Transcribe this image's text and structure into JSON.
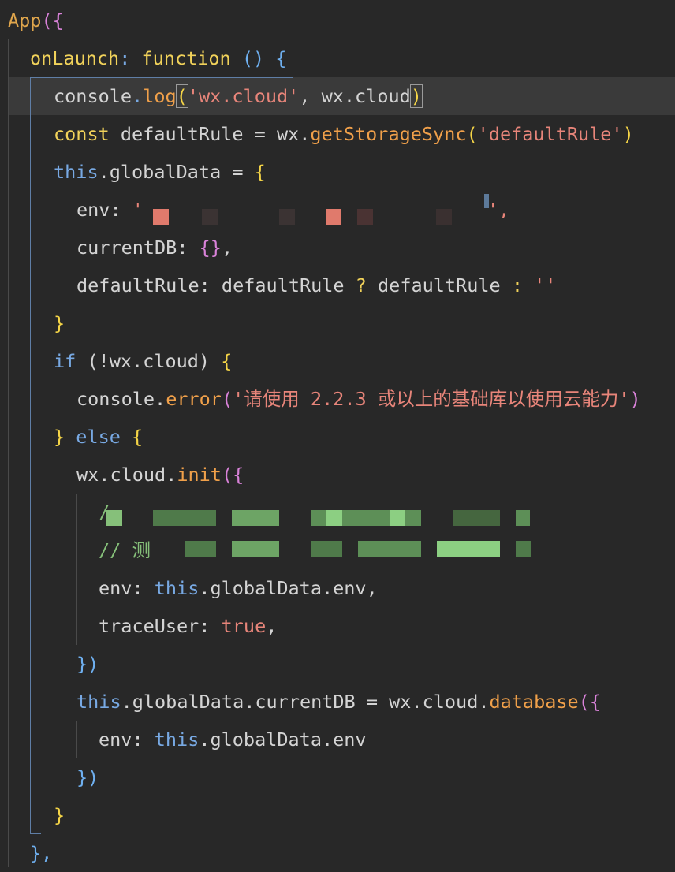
{
  "code": {
    "l1": {
      "app": "App",
      "open": "({"
    },
    "l2": {
      "name": "onLaunch",
      "colon": ":",
      "fn": "function",
      "parens": "()",
      "brace": "{"
    },
    "l3": {
      "obj": "console",
      "dot": ".",
      "method": "log",
      "open": "(",
      "str": "'wx.cloud'",
      "comma": ", ",
      "arg": "wx.cloud",
      "close": ")"
    },
    "l4": {
      "kw": "const",
      "rest": " defaultRule = wx.",
      "method": "getStorageSync",
      "open": "(",
      "str": "'defaultRule'",
      "close": ")"
    },
    "l5": {
      "kw": "this",
      "rest": ".globalData = ",
      "brace": "{"
    },
    "l6": {
      "key": "env: ",
      "quote1": "'",
      "quote2": "',"
    },
    "l7": {
      "key": "currentDB: ",
      "val": "{}",
      "comma": ","
    },
    "l8": {
      "key": "defaultRule: defaultRule ",
      "q": "?",
      "mid": " defaultRule ",
      "c": ":",
      "str": " ''"
    },
    "l9": {
      "brace": "}"
    },
    "l10": {
      "kw": "if",
      "rest": " (!wx.cloud) ",
      "brace": "{"
    },
    "l11": {
      "obj": "console.",
      "method": "error",
      "open": "(",
      "str": "'请使用 2.2.3 或以上的基础库以使用云能力'",
      "close": ")"
    },
    "l12": {
      "brace1": "}",
      "kw": " else ",
      "brace2": "{"
    },
    "l13": {
      "obj": "wx.cloud.",
      "method": "init",
      "open": "({"
    },
    "l14": {
      "text": "/"
    },
    "l15": {
      "text": "// 测"
    },
    "l16": {
      "key": "env: ",
      "kw": "this",
      "rest": ".globalData.env,"
    },
    "l17": {
      "key": "traceUser: ",
      "val": "true",
      "comma": ","
    },
    "l18": {
      "close": "})"
    },
    "l19": {
      "kw": "this",
      "rest": ".globalData.currentDB = wx.cloud.",
      "method": "database",
      "open": "({"
    },
    "l20": {
      "key": "env: ",
      "kw": "this",
      "rest": ".globalData.env"
    },
    "l21": {
      "close": "})"
    },
    "l22": {
      "brace": "}"
    },
    "l23": {
      "text": "},"
    }
  },
  "colors": {
    "background": "#282828",
    "keyword": "#78a9e3",
    "string": "#e8857a",
    "method": "#f0a04a",
    "comment": "#86c07a",
    "bracket_yellow": "#f5d547",
    "bracket_purple": "#d982d9"
  }
}
